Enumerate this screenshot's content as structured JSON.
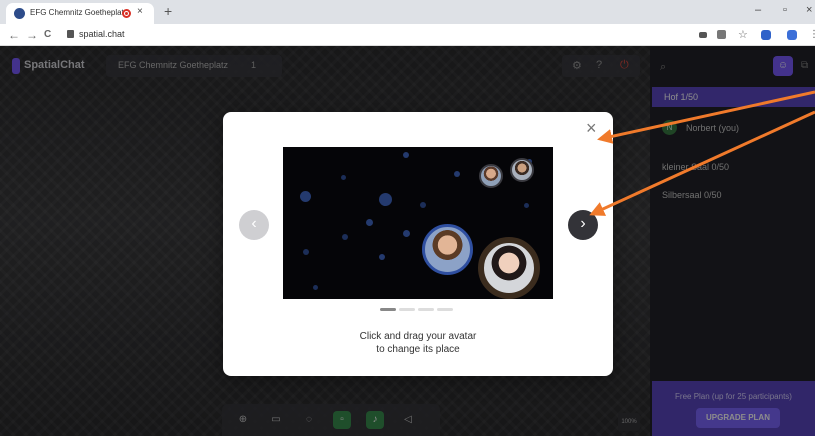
{
  "browser": {
    "tab_title": "EFG Chemnitz Goetheplatz / ",
    "tab_close": "×",
    "new_tab": "+",
    "url": "spatial.chat",
    "nav_back": "←",
    "nav_forward": "→",
    "nav_reload": "C",
    "win_minimize": "–",
    "win_maximize": "▫",
    "win_close": "×"
  },
  "app": {
    "brand": "SpatialChat",
    "room_title": "EFG Chemnitz Goetheplatz",
    "room_count": "1",
    "zoom": "100%"
  },
  "sidebar": {
    "rooms": [
      {
        "label": "Hof 1/50",
        "active": true
      },
      {
        "label": "kleiner Saal 0/50",
        "active": false
      },
      {
        "label": "Silbersaal 0/50",
        "active": false
      }
    ],
    "member": {
      "initial": "N",
      "name": "Norbert (you)"
    },
    "plan_text": "Free Plan (up for 25 participants)",
    "upgrade_label": "UPGRADE PLAN"
  },
  "modal": {
    "close": "×",
    "prev": "‹",
    "next": "›",
    "caption_line1": "Click and drag your avatar",
    "caption_line2": "to change its place",
    "page_index": 1,
    "page_count": 4
  },
  "colors": {
    "accent": "#7a5cff",
    "annotation": "#f07a2b"
  }
}
